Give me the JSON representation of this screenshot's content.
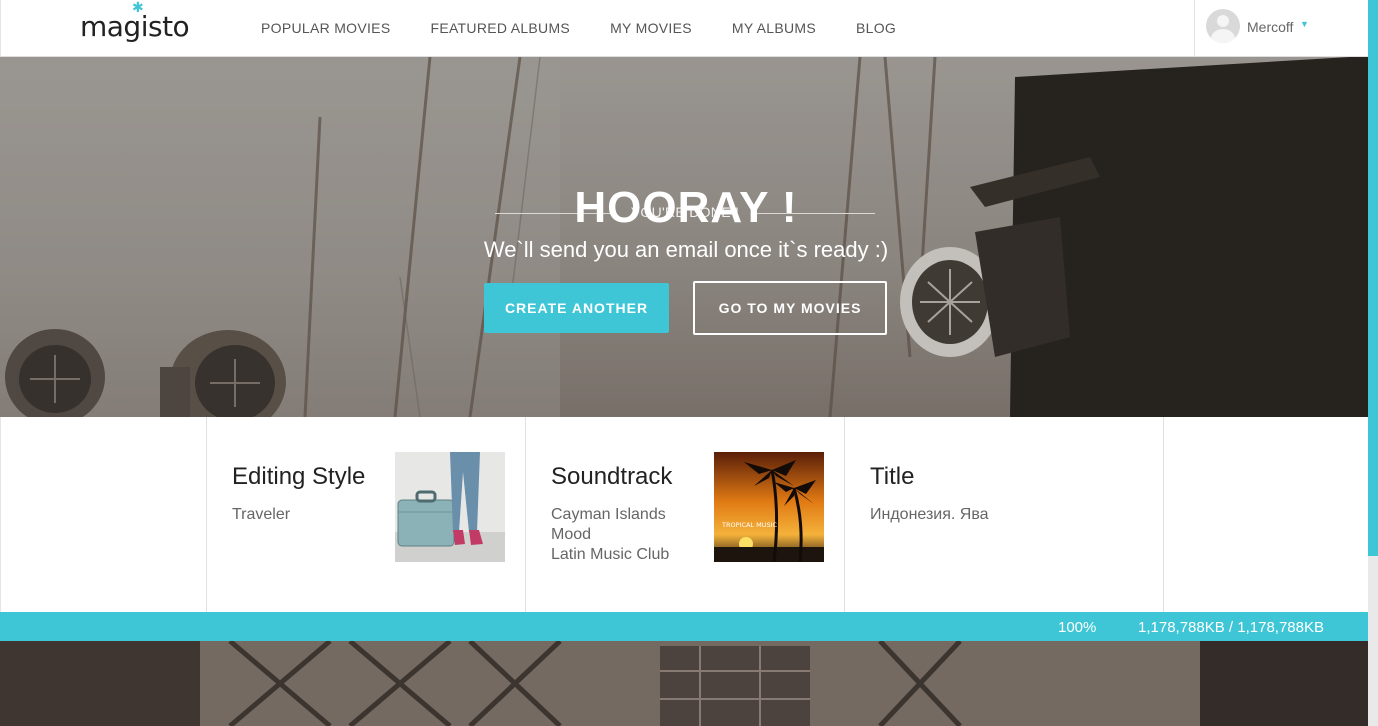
{
  "header": {
    "logo": "magisto",
    "nav": [
      {
        "label": "POPULAR MOVIES"
      },
      {
        "label": "FEATURED ALBUMS"
      },
      {
        "label": "MY MOVIES"
      },
      {
        "label": "MY ALBUMS"
      },
      {
        "label": "BLOG"
      }
    ],
    "username": "Mercoff"
  },
  "hero": {
    "eyebrow": "YOU'RE DONE !",
    "headline": "HOORAY !",
    "subtitle": "We`ll send you an email once it`s ready :)",
    "create_another": "CREATE ANOTHER",
    "go_to_my_movies": "GO TO MY MOVIES"
  },
  "cards": {
    "editing_style": {
      "title": "Editing Style",
      "value": "Traveler"
    },
    "soundtrack": {
      "title": "Soundtrack",
      "lines": [
        "Cayman Islands",
        "Mood",
        "Latin Music Club"
      ],
      "cover_text": "TROPICAL MUSIC"
    },
    "title_card": {
      "title": "Title",
      "value": "Индонезия. Ява"
    }
  },
  "upload": {
    "progress_percent": 100,
    "percent_label": "100%",
    "size_label": "1,178,788KB / 1,178,788KB"
  },
  "colors": {
    "accent": "#3ec6d6",
    "hero_overlay": "#8b8683"
  }
}
